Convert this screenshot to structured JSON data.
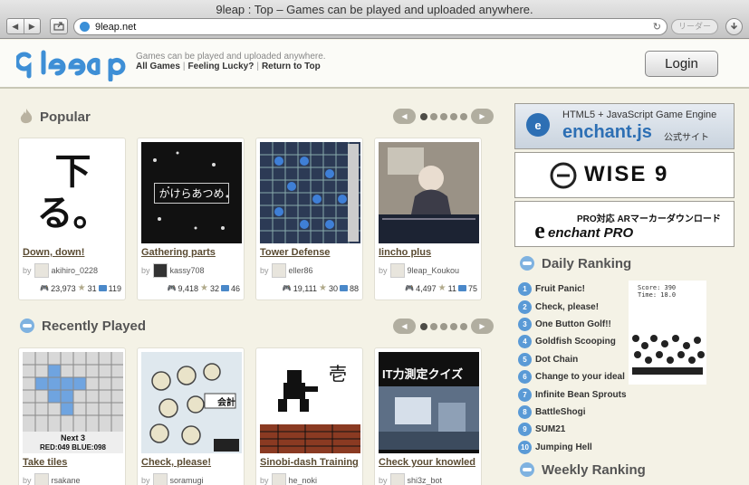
{
  "window": {
    "title": "9leap : Top – Games can be played and uploaded anywhere."
  },
  "address_bar": {
    "url": "9leap.net",
    "reader_label": "リーダー"
  },
  "header": {
    "tagline": "Games can be played and uploaded anywhere.",
    "links": [
      "All Games",
      "Feeling Lucky?",
      "Return to Top"
    ],
    "login_label": "Login"
  },
  "sections": {
    "popular": "Popular",
    "recent": "Recently Played",
    "daily": "Daily Ranking",
    "weekly": "Weekly Ranking"
  },
  "by_label": "by",
  "popular_games": [
    {
      "title": "Down, down!",
      "user": "akihiro_0228",
      "plays": "23,973",
      "stars": "31",
      "comments": "119",
      "thumb_text": "下る。"
    },
    {
      "title": "Gathering parts",
      "user": "kassy708",
      "plays": "9,418",
      "stars": "32",
      "comments": "46",
      "thumb_text": "かけらあつめ"
    },
    {
      "title": "Tower Defense",
      "user": "eller86",
      "plays": "19,111",
      "stars": "30",
      "comments": "88"
    },
    {
      "title": "Iincho plus",
      "user": "9leap_Koukou",
      "plays": "4,497",
      "stars": "11",
      "comments": "75"
    }
  ],
  "recent_games": [
    {
      "title": "Take tiles",
      "user": "rsakane",
      "thumb_text": "Next 3",
      "thumb_text2": "RED:049 BLUE:098"
    },
    {
      "title": "Check, please!",
      "user": "soramugi",
      "thumb_text": "会計"
    },
    {
      "title": "Sinobi-dash Training",
      "user": "he_noki",
      "thumb_text": "壱"
    },
    {
      "title": "Check your knowled",
      "user": "shi3z_bot",
      "thumb_text": "IT力測定クイズ"
    }
  ],
  "banners": [
    {
      "heading": "HTML5 + JavaScript Game Engine",
      "brand": "enchant.js",
      "suffix": "公式サイト"
    },
    {
      "brand": "WISE 9"
    },
    {
      "heading": "PRO対応 ARマーカーダウンロード",
      "brand": "enchant PRO"
    }
  ],
  "daily_ranking": [
    {
      "rank": "1",
      "name": "Fruit Panic!"
    },
    {
      "rank": "2",
      "name": "Check, please!"
    },
    {
      "rank": "3",
      "name": "One Button Golf!!"
    },
    {
      "rank": "4",
      "name": "Goldfish Scooping"
    },
    {
      "rank": "5",
      "name": "Dot Chain"
    },
    {
      "rank": "6",
      "name": "Change to your ideal"
    },
    {
      "rank": "7",
      "name": "Infinite Bean Sprouts"
    },
    {
      "rank": "8",
      "name": "BattleShogi"
    },
    {
      "rank": "9",
      "name": "SUM21"
    },
    {
      "rank": "10",
      "name": "Jumping Hell"
    }
  ],
  "ranking_shot": {
    "score_text": "Score: 390",
    "time_text": "Time: 18.0"
  },
  "colors": {
    "accent": "#4a88c9",
    "card_title": "#5a4b32",
    "page_bg": "#f4f2e6"
  }
}
